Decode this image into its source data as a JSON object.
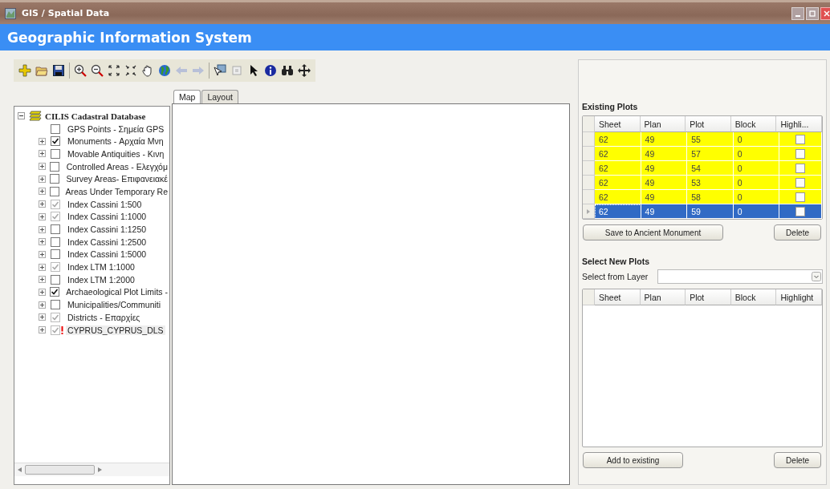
{
  "window": {
    "title": "GIS / Spatial Data"
  },
  "header": {
    "title": "Geographic Information System"
  },
  "layer_tree": {
    "root": {
      "label": "CILIS Cadastral Database",
      "expanded": true,
      "children": [
        {
          "label": "GPS Points - Σημεία GPS",
          "checked": false,
          "dimmed": false,
          "expandable": false,
          "warning": false
        },
        {
          "label": "Monuments - Αρχαία Μνη",
          "checked": true,
          "dimmed": false,
          "expandable": true,
          "warning": false
        },
        {
          "label": "Movable Antiquities - Κινη",
          "checked": false,
          "dimmed": false,
          "expandable": true,
          "warning": false
        },
        {
          "label": "Controlled Areas - Ελεγχόμ",
          "checked": false,
          "dimmed": false,
          "expandable": true,
          "warning": false
        },
        {
          "label": "Survey Areas- Επιφανειακέ",
          "checked": false,
          "dimmed": false,
          "expandable": true,
          "warning": false
        },
        {
          "label": "Areas Under Temporary Re",
          "checked": false,
          "dimmed": false,
          "expandable": true,
          "warning": false
        },
        {
          "label": "Index Cassini 1:500",
          "checked": true,
          "dimmed": true,
          "expandable": true,
          "warning": false
        },
        {
          "label": "Index Cassini 1:1000",
          "checked": true,
          "dimmed": true,
          "expandable": true,
          "warning": false
        },
        {
          "label": "Index Cassini 1:1250",
          "checked": false,
          "dimmed": false,
          "expandable": true,
          "warning": false
        },
        {
          "label": "Index Cassini 1:2500",
          "checked": false,
          "dimmed": false,
          "expandable": true,
          "warning": false
        },
        {
          "label": "Index Cassini 1:5000",
          "checked": false,
          "dimmed": false,
          "expandable": true,
          "warning": false
        },
        {
          "label": "Index LTM 1:1000",
          "checked": true,
          "dimmed": true,
          "expandable": true,
          "warning": false
        },
        {
          "label": "Index LTM 1:2000",
          "checked": false,
          "dimmed": false,
          "expandable": true,
          "warning": false
        },
        {
          "label": "Archaeological Plot Limits -",
          "checked": true,
          "dimmed": false,
          "expandable": true,
          "warning": false
        },
        {
          "label": "Municipalities/Communiti",
          "checked": false,
          "dimmed": false,
          "expandable": true,
          "warning": false
        },
        {
          "label": "Districts - Επαρχίες",
          "checked": true,
          "dimmed": true,
          "expandable": true,
          "warning": false
        },
        {
          "label": "CYPRUS_CYPRUS_DLS",
          "checked": true,
          "dimmed": true,
          "expandable": true,
          "warning": true
        }
      ]
    }
  },
  "map_tabs": [
    {
      "label": "Map",
      "selected": true
    },
    {
      "label": "Layout",
      "selected": false
    }
  ],
  "existing_plots": {
    "title": "Existing Plots",
    "columns": [
      "Sheet",
      "Plan",
      "Plot",
      "Block",
      "Highli..."
    ],
    "rows": [
      {
        "sheet": "62",
        "plan": "49",
        "plot": "55",
        "block": "0",
        "highlight": false,
        "selected": false
      },
      {
        "sheet": "62",
        "plan": "49",
        "plot": "57",
        "block": "0",
        "highlight": false,
        "selected": false
      },
      {
        "sheet": "62",
        "plan": "49",
        "plot": "54",
        "block": "0",
        "highlight": false,
        "selected": false
      },
      {
        "sheet": "62",
        "plan": "49",
        "plot": "53",
        "block": "0",
        "highlight": false,
        "selected": false
      },
      {
        "sheet": "62",
        "plan": "49",
        "plot": "58",
        "block": "0",
        "highlight": false,
        "selected": false
      },
      {
        "sheet": "62",
        "plan": "49",
        "plot": "59",
        "block": "0",
        "highlight": false,
        "selected": true
      }
    ],
    "buttons": [
      "Save to Ancient Monument",
      "Delete"
    ]
  },
  "new_plots": {
    "title": "Select New Plots",
    "layer_label": "Select from Layer",
    "columns": [
      "Sheet",
      "Plan",
      "Plot",
      "Block",
      "Highlight"
    ],
    "buttons": [
      "Add to existing",
      "Delete"
    ]
  }
}
